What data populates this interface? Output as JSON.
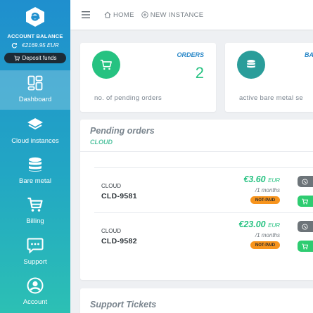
{
  "sidebar": {
    "balance_label": "ACCOUNT BALANCE",
    "balance_value": "€2169.95 EUR",
    "deposit_label": "Deposit funds",
    "items": [
      {
        "label": "Dashboard",
        "icon": "dashboard-icon",
        "active": true
      },
      {
        "label": "Cloud instances",
        "icon": "layers-icon"
      },
      {
        "label": "Bare metal",
        "icon": "database-icon"
      },
      {
        "label": "Billing",
        "icon": "cart-icon"
      },
      {
        "label": "Support",
        "icon": "chat-icon"
      },
      {
        "label": "Account",
        "icon": "user-icon"
      }
    ]
  },
  "topbar": {
    "home_label": "HOME",
    "new_instance_label": "NEW INSTANCE"
  },
  "stats": {
    "orders": {
      "title": "ORDERS",
      "value": "2",
      "caption": "no. of pending orders"
    },
    "bare_metal": {
      "title": "BA",
      "caption": "active bare metal se"
    }
  },
  "pending": {
    "title": "Pending orders",
    "subtitle": "CLOUD",
    "orders": [
      {
        "type": "CLOUD",
        "id": "CLD-9581",
        "price": "€3.60",
        "currency": "EUR",
        "period": "/1 months",
        "status": "NOT-PAID"
      },
      {
        "type": "CLOUD",
        "id": "CLD-9582",
        "price": "€23.00",
        "currency": "EUR",
        "period": "/1 months",
        "status": "NOT-PAID"
      }
    ]
  },
  "support": {
    "title": "Support Tickets"
  },
  "colors": {
    "accent_green": "#26c281",
    "sidebar_top": "#1f8fce",
    "sidebar_bottom": "#2cc0b4",
    "badge_orange": "#f7941d",
    "bare_metal_teal": "#2a9d9a"
  }
}
